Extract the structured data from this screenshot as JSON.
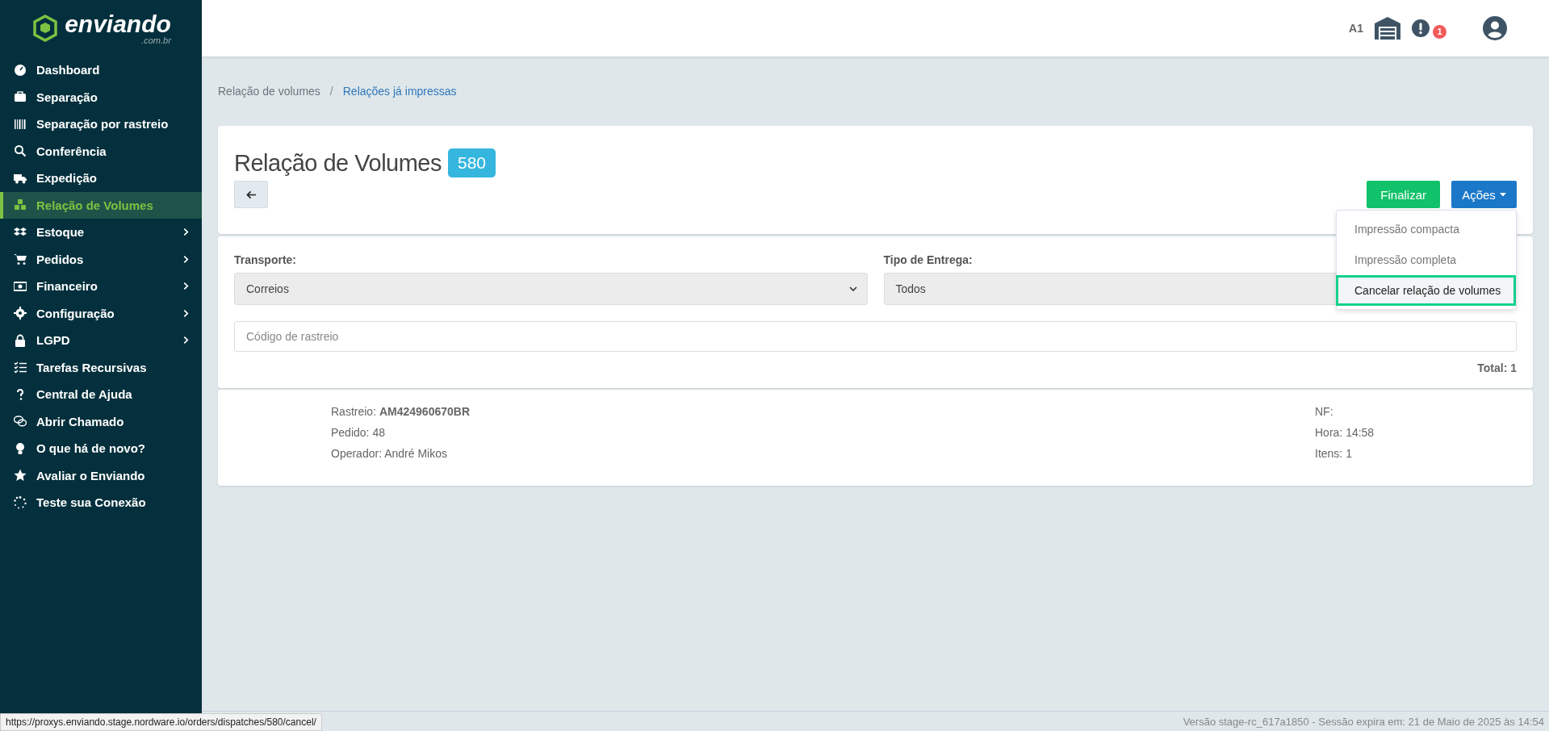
{
  "logo": {
    "name": "enviando",
    "domain": ".com.br"
  },
  "sidebar": {
    "items": [
      {
        "label": "Dashboard",
        "selected": false,
        "expandable": false
      },
      {
        "label": "Separação",
        "selected": false,
        "expandable": false
      },
      {
        "label": "Separação por rastreio",
        "selected": false,
        "expandable": false
      },
      {
        "label": "Conferência",
        "selected": false,
        "expandable": false
      },
      {
        "label": "Expedição",
        "selected": false,
        "expandable": false
      },
      {
        "label": "Relação de Volumes",
        "selected": true,
        "expandable": false
      },
      {
        "label": "Estoque",
        "selected": false,
        "expandable": true
      },
      {
        "label": "Pedidos",
        "selected": false,
        "expandable": true
      },
      {
        "label": "Financeiro",
        "selected": false,
        "expandable": true
      },
      {
        "label": "Configuração",
        "selected": false,
        "expandable": true
      },
      {
        "label": "LGPD",
        "selected": false,
        "expandable": true
      },
      {
        "label": "Tarefas Recursivas",
        "selected": false,
        "expandable": false
      },
      {
        "label": "Central de Ajuda",
        "selected": false,
        "expandable": false
      },
      {
        "label": "Abrir Chamado",
        "selected": false,
        "expandable": false
      },
      {
        "label": "O que há de novo?",
        "selected": false,
        "expandable": false
      },
      {
        "label": "Avaliar o Enviando",
        "selected": false,
        "expandable": false
      },
      {
        "label": "Teste sua Conexão",
        "selected": false,
        "expandable": false
      }
    ]
  },
  "header": {
    "user_code": "A1",
    "notification_count": "1"
  },
  "breadcrumb": {
    "separator": "/",
    "items": [
      {
        "label": "Relação de volumes",
        "link": false
      },
      {
        "label": "Relações já impressas",
        "link": true
      }
    ]
  },
  "page": {
    "title": "Relação de Volumes",
    "badge": "580"
  },
  "actions": {
    "finish": "Finalizar",
    "menu": "Ações",
    "menu_items": [
      {
        "label": "Impressão compacta",
        "selected": false
      },
      {
        "label": "Impressão completa",
        "selected": false
      },
      {
        "label": "Cancelar relação de volumes",
        "selected": true
      }
    ]
  },
  "filters": {
    "transport": {
      "label": "Transporte:",
      "value": "Correios"
    },
    "delivery_type": {
      "label": "Tipo de Entrega:",
      "value": "Todos"
    },
    "tracking": {
      "placeholder": "Código de rastreio"
    },
    "total": "Total: 1"
  },
  "volume": {
    "left": [
      {
        "label": "Rastreio:",
        "value": "AM424960670BR",
        "bold": true
      },
      {
        "label": "Pedido:",
        "value": "48",
        "bold": false
      },
      {
        "label": "Operador:",
        "value": "André Mikos",
        "bold": false
      }
    ],
    "right": [
      {
        "label": "NF:"
      },
      {
        "label": "Hora:",
        "value": "14:58",
        "bold": false
      },
      {
        "label": "Itens:",
        "value": "1",
        "bold": false
      }
    ]
  },
  "status_url": "https://proxys.enviando.stage.nordware.io/orders/dispatches/580/cancel/",
  "footer": "Versão stage-rc_617a1850 - Sessão expira em: 21 de Maio de 2025 às 14:54"
}
